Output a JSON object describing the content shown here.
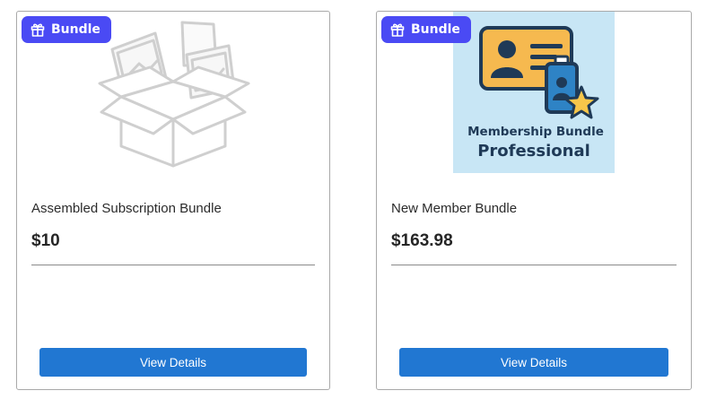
{
  "colors": {
    "badge": "#4a4af4",
    "button": "#2177d2",
    "card_border": "#a9a9a9",
    "membership_bg": "#c8e6f5",
    "card_icon_yellow": "#f6b94f",
    "card_icon_blue": "#2e83c5",
    "star": "#f7c64a",
    "membership_text": "#1f3a57"
  },
  "products": [
    {
      "badge_label": "Bundle",
      "badge_icon": "gift-icon",
      "image_icon": "open-box-placeholder-icon",
      "title": "Assembled Subscription Bundle",
      "price": "$10",
      "button_label": "View Details"
    },
    {
      "badge_label": "Bundle",
      "badge_icon": "gift-icon",
      "image_icon": "id-card-star-icon",
      "image_caption_line1": "Membership Bundle",
      "image_caption_line2": "Professional",
      "title": "New Member Bundle",
      "price": "$163.98",
      "button_label": "View Details"
    }
  ]
}
